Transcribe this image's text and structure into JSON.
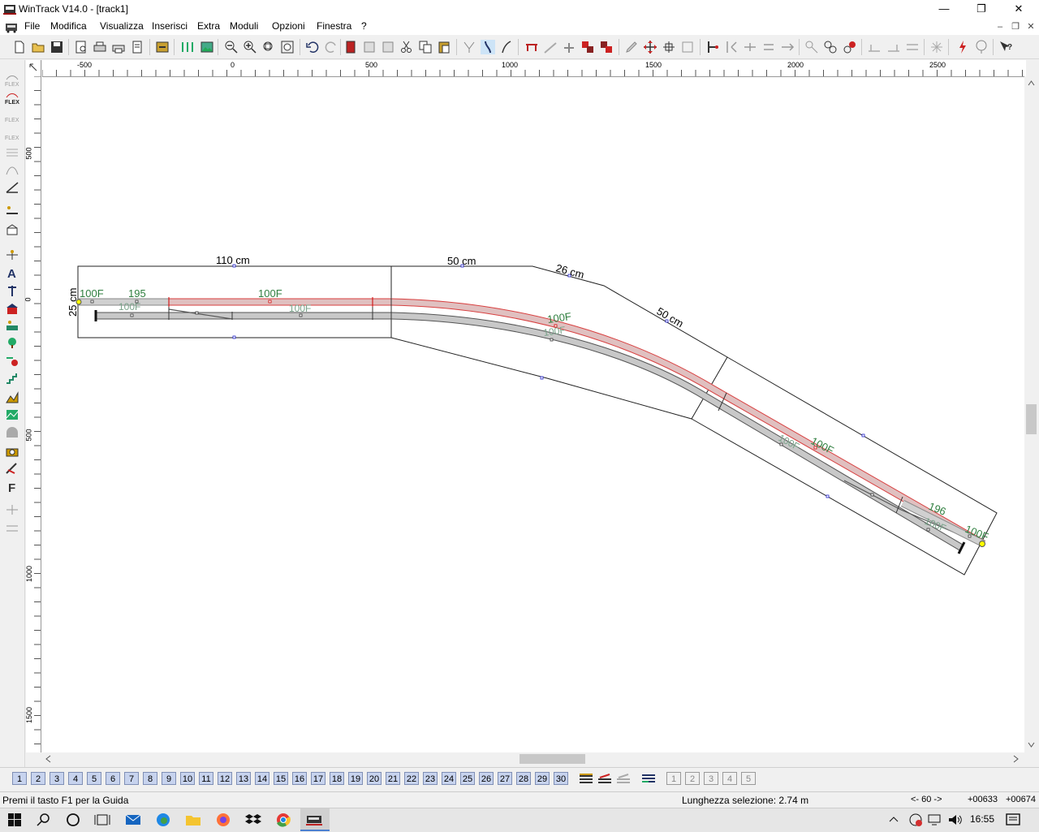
{
  "window": {
    "title": "WinTrack  V14.0 - [track1]",
    "minimize_glyph": "—",
    "restore_glyph": "❐",
    "close_glyph": "✕"
  },
  "menu": {
    "items": [
      "File",
      "Modifica",
      "Visualizza",
      "Inserisci",
      "Extra",
      "Moduli",
      "Opzioni",
      "Finestra",
      "?"
    ]
  },
  "mdi": {
    "minimize": "–",
    "restore": "❐",
    "close": "✕"
  },
  "ruler": {
    "h_labels": [
      "-500",
      "0",
      "500",
      "1000",
      "1500",
      "2000",
      "2500"
    ],
    "v_labels": [
      "500",
      "0",
      "500",
      "1000",
      "1500"
    ]
  },
  "drawing": {
    "dims": {
      "d110": "110 cm",
      "d50a": "50 cm",
      "d26": "26 cm",
      "d50b": "50 cm",
      "d25": "25 cm"
    },
    "track_labels": {
      "l100f_a": "100F",
      "l195": "195",
      "l100f_b": "100F",
      "l100f_c": "100F",
      "l100f_d": "100F",
      "l100f_e": "100F",
      "l100f_f": "100F",
      "l196": "196",
      "l100f_g": "100F",
      "l100f_h": "100F",
      "l100f_i": "100F",
      "l100f_j": "100F"
    }
  },
  "layers": {
    "buttons": [
      "1",
      "2",
      "3",
      "4",
      "5",
      "6",
      "7",
      "8",
      "9",
      "10",
      "11",
      "12",
      "13",
      "14",
      "15",
      "16",
      "17",
      "18",
      "19",
      "20",
      "21",
      "22",
      "23",
      "24",
      "25",
      "26",
      "27",
      "28",
      "29",
      "30"
    ],
    "extra": [
      "1",
      "2",
      "3",
      "4",
      "5"
    ]
  },
  "status": {
    "help": "Premi il tasto F1 per la Guida",
    "selection": "Lunghezza selezione: 2.74 m",
    "angle": "<- 60 ->",
    "x": "+00633",
    "y": "+00674"
  },
  "taskbar": {
    "time": "16:55"
  },
  "colors": {
    "track_gray": "#c8c8c8",
    "track_red": "#d84040",
    "label_green": "#2f7f3f"
  }
}
